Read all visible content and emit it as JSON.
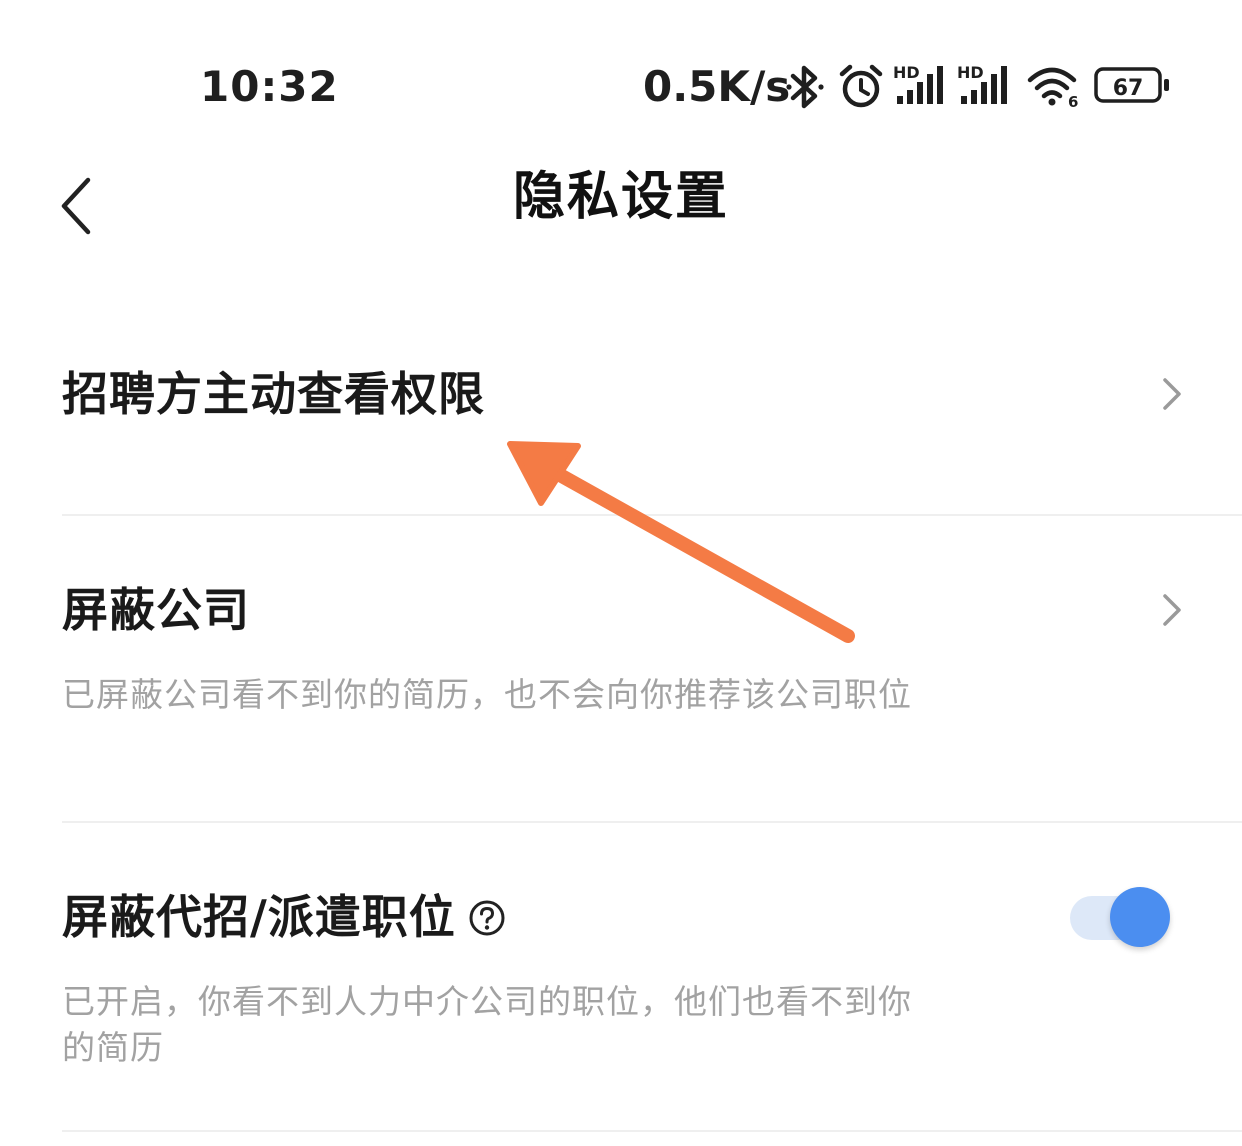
{
  "status_bar": {
    "time": "10:32",
    "net_speed": "0.5K/s",
    "signal1_label": "HD",
    "signal2_label": "HD",
    "wifi_label": "6",
    "battery_level": "67",
    "icons": [
      "bluetooth-icon",
      "alarm-icon",
      "signal-hd-icon",
      "signal-hd-icon",
      "wifi-6-icon",
      "battery-icon"
    ]
  },
  "header": {
    "title": "隐私设置",
    "back_icon": "chevron-left-icon"
  },
  "settings": {
    "items": [
      {
        "title": "招聘方主动查看权限",
        "description": "",
        "control": "chevron-right-icon"
      },
      {
        "title": "屏蔽公司",
        "description": "已屏蔽公司看不到你的简历，也不会向你推荐该公司职位",
        "control": "chevron-right-icon"
      },
      {
        "title": "屏蔽代招/派遣职位",
        "description": "已开启，你看不到人力中介公司的职位，他们也看不到你的简历",
        "control": "toggle",
        "toggle_on": true,
        "help_icon": "question-circle-icon"
      }
    ]
  },
  "colors": {
    "toggle_knob": "#4b8ef0",
    "toggle_track": "#dde8f8",
    "annotation_arrow": "#f47b45",
    "description_text": "#a2a2a2",
    "divider": "#efefef"
  }
}
